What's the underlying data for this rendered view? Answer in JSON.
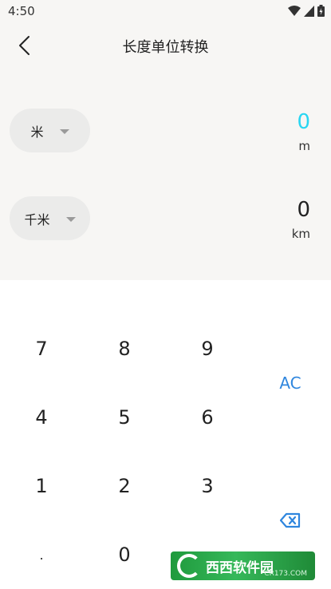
{
  "status_bar": {
    "time": "4:50"
  },
  "app_bar": {
    "title": "长度单位转换"
  },
  "converter": {
    "from": {
      "unit_name": "米",
      "value": "0",
      "unit_symbol": "m"
    },
    "to": {
      "unit_name": "千米",
      "value": "0",
      "unit_symbol": "km"
    },
    "active_color": "#29d6f2"
  },
  "keypad": {
    "keys": [
      "7",
      "8",
      "9",
      "4",
      "5",
      "6",
      "1",
      "2",
      "3",
      ".",
      "0"
    ],
    "clear_label": "AC",
    "accent_color": "#2f86de"
  },
  "watermark": {
    "text": "西西软件园",
    "sub": "CR173.COM"
  }
}
